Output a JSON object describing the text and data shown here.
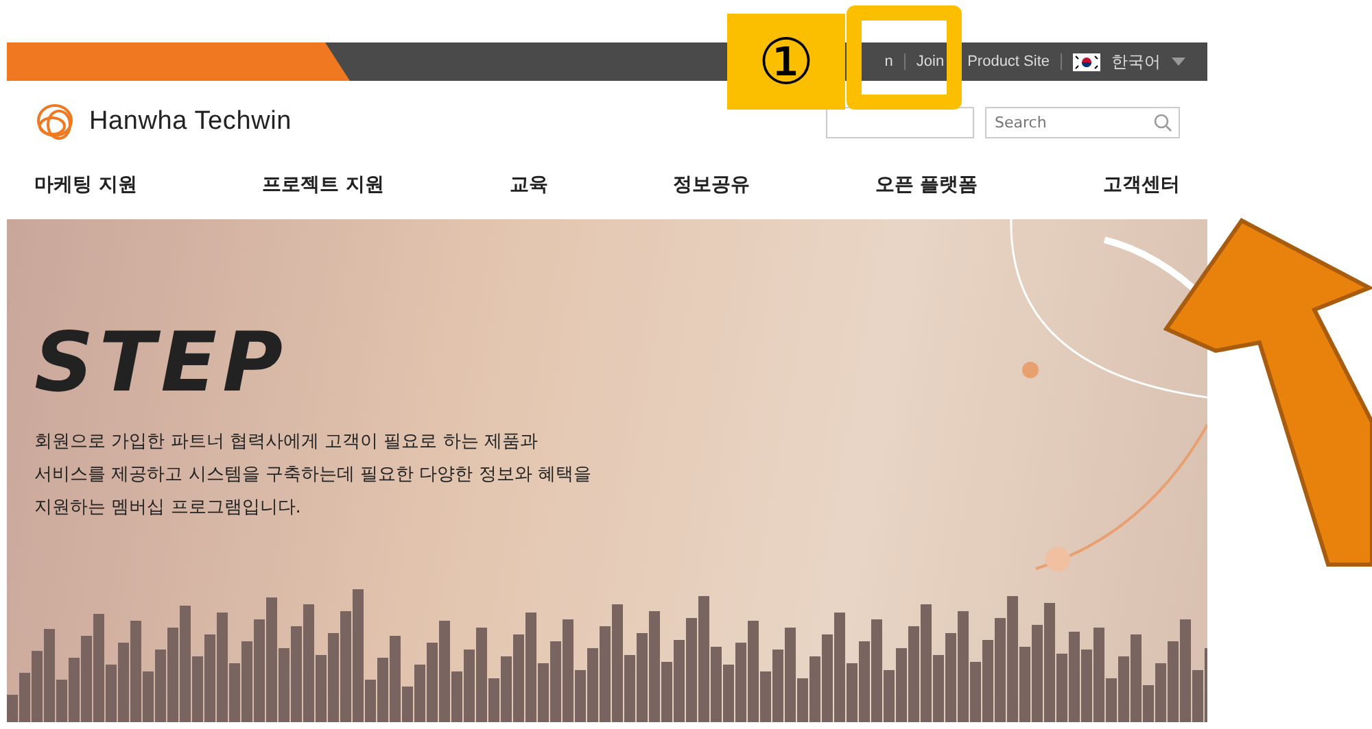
{
  "top_bar": {
    "links": [
      {
        "label": "n"
      },
      {
        "label": "Join"
      },
      {
        "label": "Product Site"
      }
    ],
    "language": "한국어"
  },
  "header": {
    "logo": "Hanwha Techwin",
    "search": {
      "placeholder": "Search"
    }
  },
  "nav": [
    "마케팅 지원",
    "프로젝트 지원",
    "교육",
    "정보공유",
    "오픈 플랫폼",
    "고객센터"
  ],
  "hero": {
    "title": "STEP",
    "description": "회원으로 가입한 파트너 협력사에게 고객이 필요로 하는 제품과\n서비스를 제공하고 시스템을 구축하는데 필요한 다양한 정보와 혜택을\n지원하는 멤버십 프로그램입니다."
  },
  "annotation": {
    "label": "①"
  }
}
